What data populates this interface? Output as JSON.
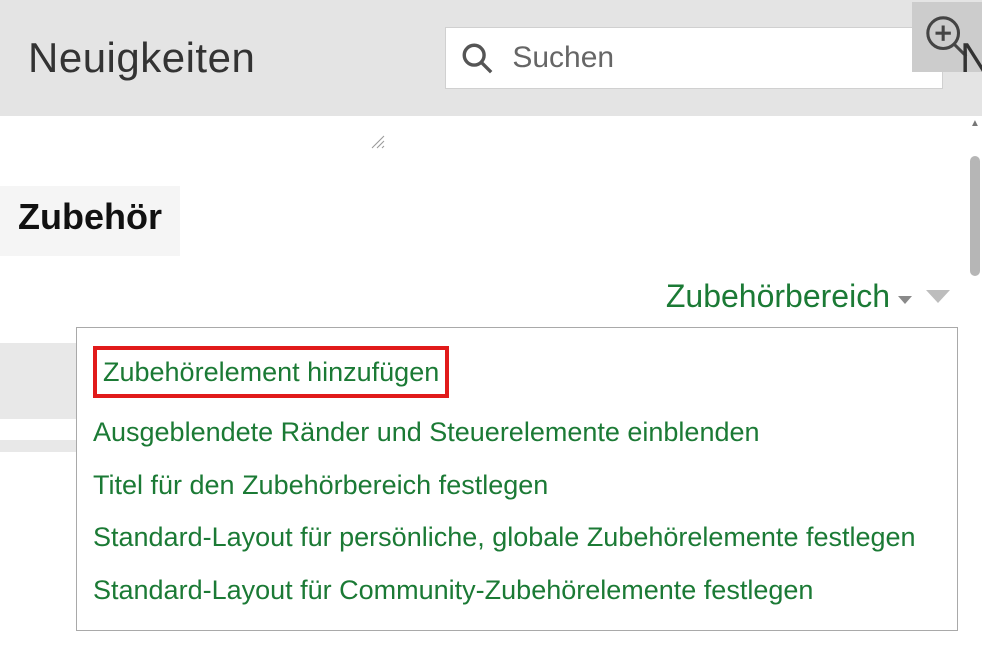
{
  "header": {
    "title": "Neuigkeiten",
    "search_placeholder": "Suchen",
    "clipped_text": "Ne"
  },
  "section": {
    "title": "Zubehör"
  },
  "dropdown": {
    "label": "Zubehörbereich",
    "items": [
      "Zubehörelement hinzufügen",
      "Ausgeblendete Ränder und Steuerelemente einblenden",
      "Titel für den Zubehörbereich festlegen",
      "Standard-Layout für persönliche, globale Zubehörelemente festlegen",
      "Standard-Layout für Community-Zubehörelemente festlegen"
    ]
  },
  "icons": {
    "search": "search-icon",
    "zoom": "zoom-in-icon"
  }
}
